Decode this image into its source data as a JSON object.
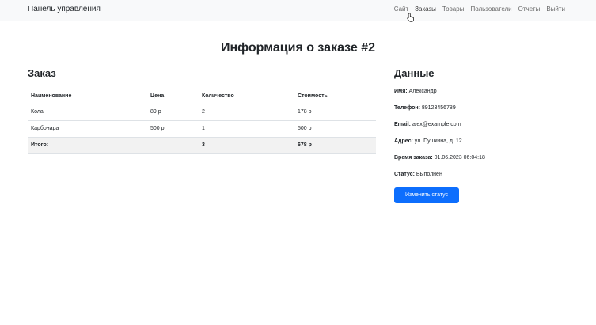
{
  "navbar": {
    "brand": "Панель управления",
    "links": [
      "Сайт",
      "Заказы",
      "Товары",
      "Пользователи",
      "Отчеты",
      "Выйти"
    ]
  },
  "page": {
    "title": "Информация о заказе #2"
  },
  "order": {
    "title": "Заказ",
    "headers": [
      "Наименование",
      "Цена",
      "Количество",
      "Стоимость"
    ],
    "rows": [
      [
        "Кола",
        "89 р",
        "2",
        "178 р"
      ],
      [
        "Карбонара",
        "500 р",
        "1",
        "500 р"
      ]
    ],
    "total": [
      "Итого:",
      "",
      "3",
      "678 р"
    ]
  },
  "details": {
    "title": "Данные",
    "name_label": "Имя:",
    "name_value": " Александр",
    "phone_label": "Телефон:",
    "phone_value": " 89123456789",
    "email_label": "Email:",
    "email_value": " alex@example.com",
    "address_label": "Адрес:",
    "address_value": " ул. Пушкина, д. 12",
    "time_label": "Время заказа:",
    "time_value": " 01.06.2023 06:04:18",
    "status_label": "Статус:",
    "status_value": " Выполнен",
    "change_status_label": "Изменить статус"
  },
  "colors": {
    "accent": "#0d6efd",
    "navbar_bg": "#f8f9fa"
  }
}
